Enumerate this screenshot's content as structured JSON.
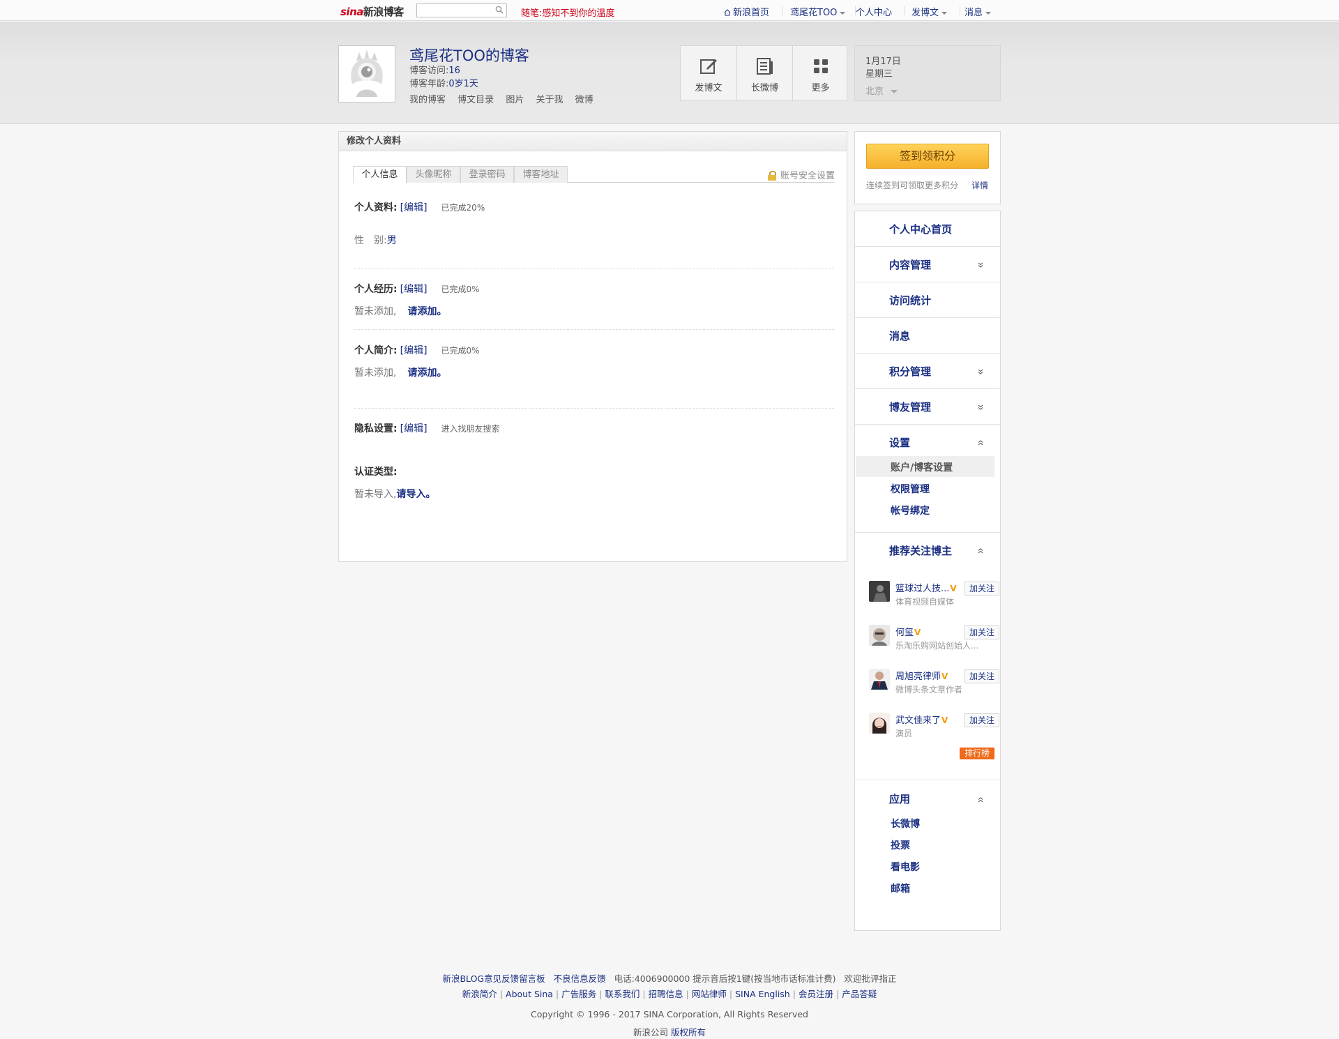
{
  "topbar": {
    "logo_mark": "sina",
    "logo_text": "新浪博客",
    "search_value": "",
    "suibi_label": "随笔:",
    "suibi_text": "感知不到你的温度",
    "nav": {
      "home": "新浪首页",
      "user": "鸢尾花TOO",
      "center": "个人中心",
      "post": "发博文",
      "messages": "消息"
    }
  },
  "header": {
    "blog_title": "鸢尾花TOO的博客",
    "visits_label": "博客访问:",
    "visits_value": "16",
    "age_label": "博客年龄:",
    "age_value": "0岁1天",
    "links": [
      "我的博客",
      "博文目录",
      "图片",
      "关于我",
      "微博"
    ],
    "tools": [
      {
        "label": "发博文",
        "icon": "edit-icon"
      },
      {
        "label": "长微博",
        "icon": "long-weibo-icon"
      },
      {
        "label": "更多",
        "icon": "grid-icon"
      }
    ],
    "date": "1月17日",
    "weekday": "星期三",
    "city": "北京"
  },
  "main": {
    "panel_title": "修改个人资料",
    "tabs": [
      "个人信息",
      "头像昵称",
      "登录密码",
      "博客地址"
    ],
    "security_link": "账号安全设置",
    "profile": {
      "label": "个人资料:",
      "edit": "[编辑]",
      "progress": "已完成20%"
    },
    "gender": {
      "label": "性　别:",
      "value": "男"
    },
    "experience": {
      "label": "个人经历:",
      "edit": "[编辑]",
      "progress": "已完成0%",
      "empty": "暂未添加,",
      "add": "请添加。"
    },
    "intro": {
      "label": "个人简介:",
      "edit": "[编辑]",
      "progress": "已完成0%",
      "empty": "暂未添加,",
      "add": "请添加。"
    },
    "privacy": {
      "label": "隐私设置:",
      "edit": "[编辑]",
      "note": "进入找朋友搜索"
    },
    "auth": {
      "label": "认证类型:",
      "empty": "暂未导入,",
      "import": "请导入。"
    }
  },
  "sidebar": {
    "checkin_button": "签到领积分",
    "checkin_tip": "连续签到可领取更多积分",
    "checkin_more": "详情",
    "menu": {
      "home": "个人中心首页",
      "content": "内容管理",
      "stats": "访问统计",
      "messages": "消息",
      "points": "积分管理",
      "friends": "博友管理",
      "settings": "设置",
      "settings_items": [
        "账户/博客设置",
        "权限管理",
        "帐号绑定"
      ],
      "recommend": "推荐关注博主",
      "apps": "应用",
      "app_items": [
        "长微博",
        "投票",
        "看电影",
        "邮箱"
      ]
    },
    "recommended": [
      {
        "name": "篮球过人技...",
        "desc": "体育视频自媒体",
        "follow": "加关注"
      },
      {
        "name": "何玺",
        "desc": "乐淘乐购网站创始人...",
        "follow": "加关注"
      },
      {
        "name": "周旭亮律师",
        "desc": "微博头条文章作者",
        "follow": "加关注"
      },
      {
        "name": "武文佳来了",
        "desc": "演员",
        "follow": "加关注"
      }
    ],
    "verified_mark": "V",
    "rank_button": "排行榜"
  },
  "footer": {
    "line1": [
      "新浪BLOG意见反馈留言板",
      "不良信息反馈",
      "电话:4006900000 提示音后按1键(按当地市话标准计费)",
      "欢迎批评指正"
    ],
    "line2": [
      "新浪简介",
      "About Sina",
      "广告服务",
      "联系我们",
      "招聘信息",
      "网站律师",
      "SINA English",
      "会员注册",
      "产品答疑"
    ],
    "copyright": "Copyright © 1996 - 2017 SINA Corporation, All Rights Reserved",
    "company": "新浪公司",
    "rights": "版权所有"
  }
}
